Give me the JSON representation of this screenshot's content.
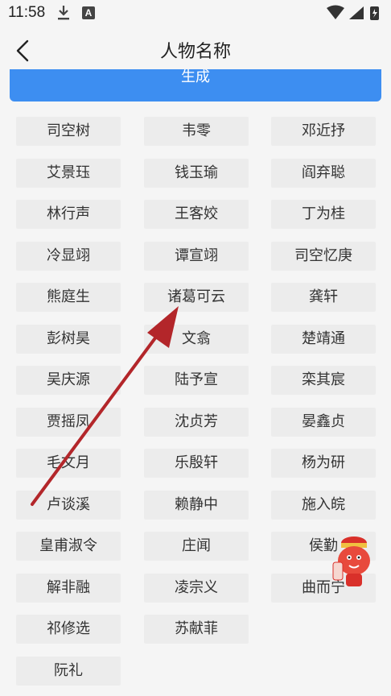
{
  "status": {
    "time": "11:58"
  },
  "header": {
    "title": "人物名称"
  },
  "generate_label": "生成",
  "names": [
    [
      "司空树",
      "韦零",
      "邓近抒"
    ],
    [
      "艾景珏",
      "钱玉瑜",
      "阎弃聪"
    ],
    [
      "林行声",
      "王客姣",
      "丁为桂"
    ],
    [
      "冷显翊",
      "谭宣翊",
      "司空忆庚"
    ],
    [
      "熊庭生",
      "诸葛可云",
      "龚轩"
    ],
    [
      "彭树昊",
      "文翕",
      "楚靖通"
    ],
    [
      "吴庆源",
      "陆予宣",
      "栾其宸"
    ],
    [
      "贾摇凤",
      "沈贞芳",
      "晏鑫贞"
    ],
    [
      "毛文月",
      "乐殷轩",
      "杨为研"
    ],
    [
      "卢谈溪",
      "赖静中",
      "施入皖"
    ],
    [
      "皇甫淑令",
      "庄闻",
      "侯勤"
    ],
    [
      "解非融",
      "凌宗义",
      "曲而宁"
    ],
    [
      "祁修选",
      "苏献菲"
    ],
    [
      "阮礼"
    ]
  ],
  "colors": {
    "accent": "#3d8ef1",
    "arrow": "#b3262a"
  }
}
